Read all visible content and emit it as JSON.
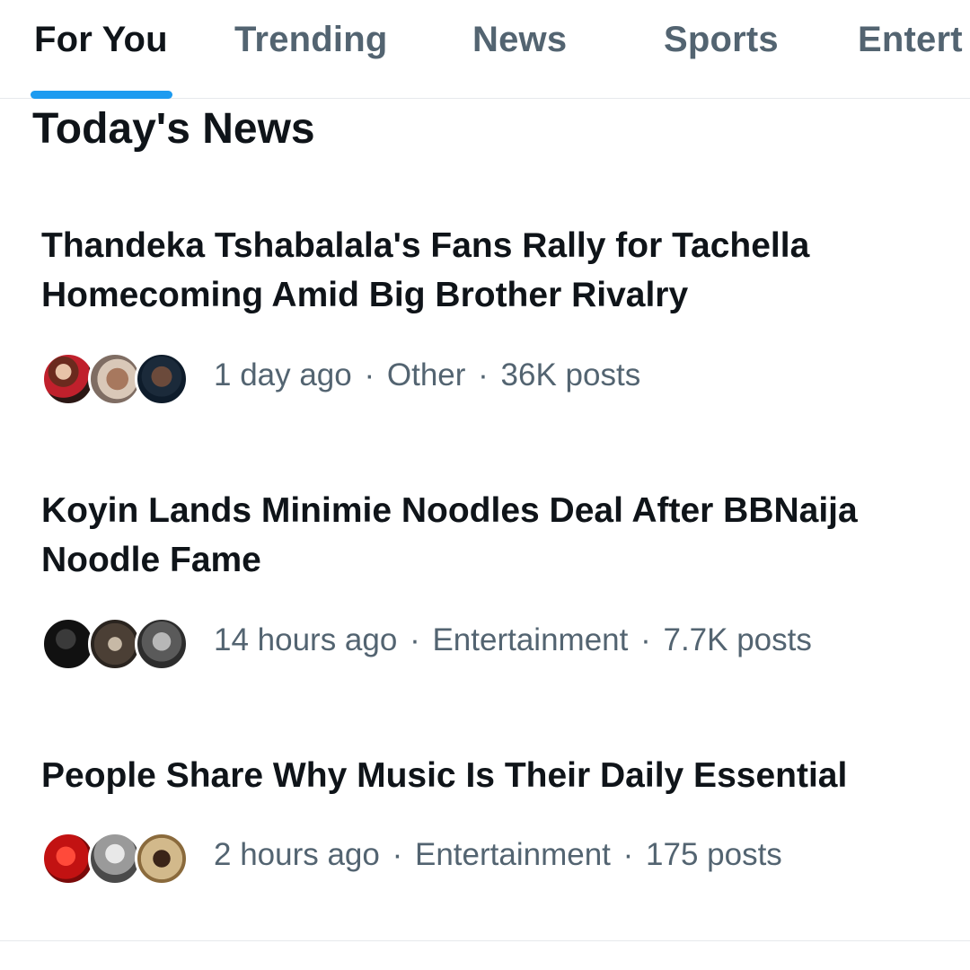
{
  "tabs": [
    {
      "label": "For You",
      "active": true
    },
    {
      "label": "Trending",
      "active": false
    },
    {
      "label": "News",
      "active": false
    },
    {
      "label": "Sports",
      "active": false
    },
    {
      "label": "Entert",
      "active": false
    }
  ],
  "accent_color": "#1d9bf0",
  "section_title": "Today's News",
  "news": [
    {
      "headline": "Thandeka Tshabalala's Fans Rally for Tachella Homecoming Amid Big Brother Rivalry",
      "time": "1 day ago",
      "category": "Other",
      "posts": "36K posts",
      "avatars": [
        "avatar-photo",
        "avatar-photo",
        "avatar-photo"
      ]
    },
    {
      "headline": "Koyin Lands Minimie Noodles Deal After BBNaija Noodle Fame",
      "time": "14 hours ago",
      "category": "Entertainment",
      "posts": "7.7K posts",
      "avatars": [
        "avatar-photo",
        "avatar-photo",
        "avatar-photo"
      ]
    },
    {
      "headline": "People Share Why Music Is Their Daily Essential",
      "time": "2 hours ago",
      "category": "Entertainment",
      "posts": "175 posts",
      "avatars": [
        "avatar-photo",
        "avatar-photo",
        "avatar-photo"
      ]
    }
  ],
  "meta_separator": "·"
}
